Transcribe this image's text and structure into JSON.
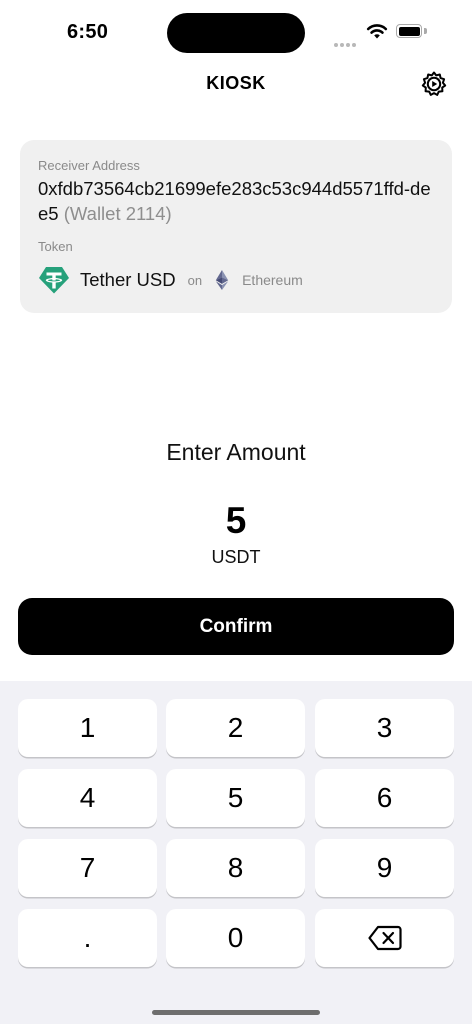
{
  "status_bar": {
    "time": "6:50"
  },
  "nav": {
    "title": "KIOSK",
    "settings_icon": "gear-icon"
  },
  "receiver": {
    "label": "Receiver Address",
    "address": "0xfdb73564cb21699efe283c53c944d5571ffd-dee5",
    "wallet": "(Wallet 2114)"
  },
  "token": {
    "label": "Token",
    "name": "Tether USD",
    "on_text": "on",
    "chain": "Ethereum",
    "token_icon": "tether-icon",
    "chain_icon": "ethereum-icon",
    "token_color": "#26A17B"
  },
  "amount": {
    "prompt": "Enter Amount",
    "value": "5",
    "unit": "USDT"
  },
  "confirm": {
    "label": "Confirm"
  },
  "keypad": {
    "keys": [
      "1",
      "2",
      "3",
      "4",
      "5",
      "6",
      "7",
      "8",
      "9",
      ".",
      "0"
    ],
    "backspace_icon": "backspace-icon"
  }
}
